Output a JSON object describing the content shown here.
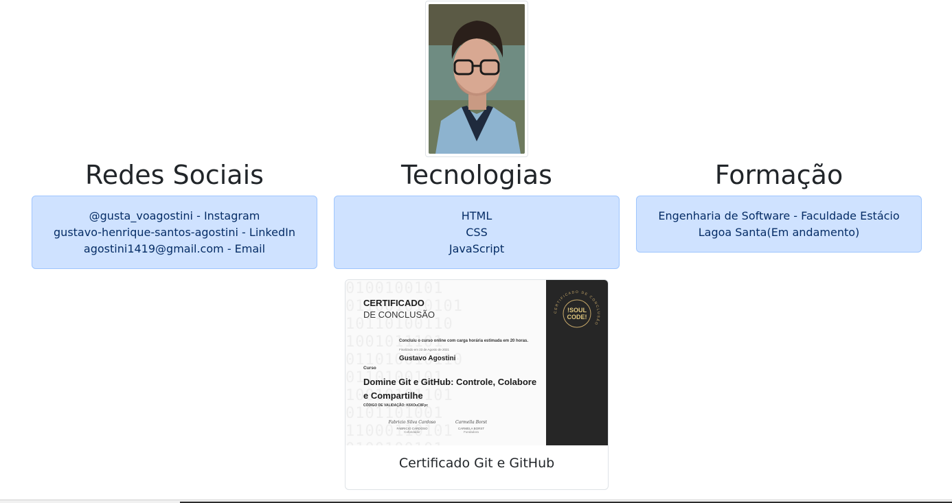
{
  "profile": {
    "photo_alt": "Gustavo Agostini"
  },
  "columns": [
    {
      "title": "Redes Sociais",
      "lines": [
        "@gusta_voagostini - Instagram",
        "gustavo-henrique-santos-agostini - LinkedIn",
        "agostini1419@gmail.com - Email"
      ]
    },
    {
      "title": "Tecnologias",
      "lines": [
        "HTML",
        "CSS",
        "JavaScript"
      ]
    },
    {
      "title": "Formação",
      "lines": [
        "Engenharia de Software - Faculdade Estácio Lagoa Santa(Em andamento)"
      ]
    }
  ],
  "certificate": {
    "heading": "CERTIFICADO",
    "subheading": "DE CONCLUSÃO",
    "completion_text": "Concluiu o curso online com carga horária estimada em 20 horas.",
    "date_text": "Finalizado em 23 de Agosto de 2021",
    "student": "Gustavo Agostini",
    "course_label": "Curso",
    "course_name": "Domine Git e GitHub: Controle, Colabore e Compartilhe",
    "validation": "CÓDIGO DE VALIDAÇÃO: K6XOuC8Fyc",
    "seal_text": "!SOUL CODE!",
    "seal_line1": "!SOUL",
    "seal_line2": "CODE!",
    "seal_ring": "CERTIFICADO DE CONCLUSÃO",
    "signer1_sig": "Fabricio Silva Cardoso",
    "signer1_name": "FABRICIO CARDOSO",
    "signer1_role": "Cofundador",
    "signer2_sig": "Carmella Borst",
    "signer2_name": "CARMELA BORST",
    "signer2_role": "Fundadora",
    "caption": "Certificado Git e GitHub"
  },
  "colors": {
    "box_bg": "#cfe2ff",
    "box_border": "#9ec5fe",
    "box_text": "#052c65",
    "heading": "#212529"
  }
}
